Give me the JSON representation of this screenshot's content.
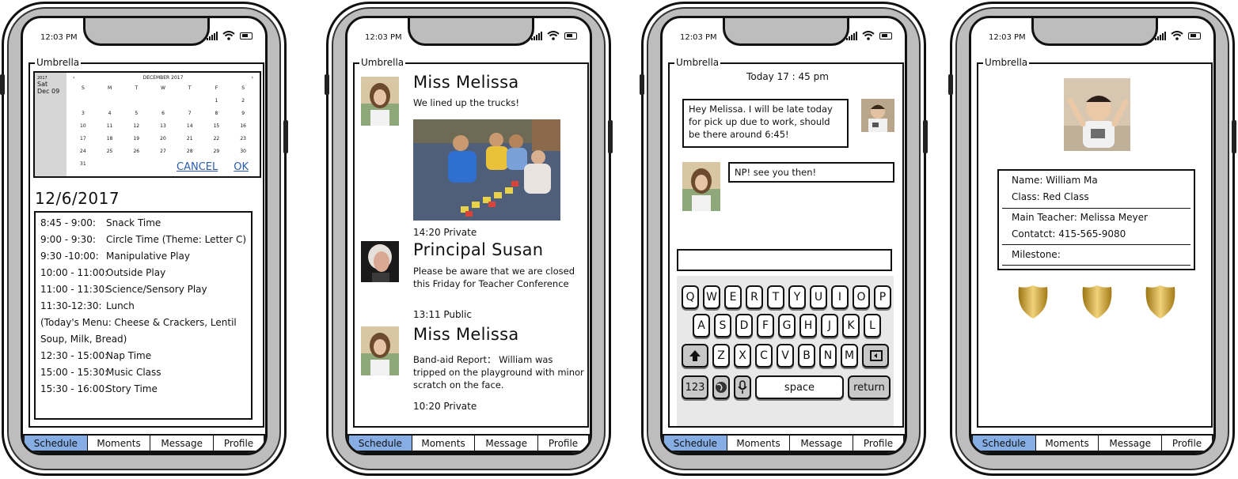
{
  "status": {
    "time": "12:03 PM"
  },
  "app": {
    "title": "Umbrella"
  },
  "tabs": [
    "Schedule",
    "Moments",
    "Message",
    "Profile"
  ],
  "calendar": {
    "year": "2017",
    "weekday": "Sat",
    "date": "Dec 09",
    "month_label": "DECEMBER 2017",
    "prev": "‹",
    "next": "›",
    "weekdays": [
      "S",
      "M",
      "T",
      "W",
      "T",
      "F",
      "S"
    ],
    "days": [
      "",
      "",
      "",
      "",
      "",
      "1",
      "2",
      "3",
      "4",
      "5",
      "6",
      "7",
      "8",
      "9",
      "10",
      "11",
      "12",
      "13",
      "14",
      "15",
      "16",
      "17",
      "18",
      "19",
      "20",
      "21",
      "22",
      "23",
      "24",
      "25",
      "26",
      "27",
      "28",
      "29",
      "30",
      "31"
    ],
    "selected_day": "9",
    "cancel": "CANCEL",
    "ok": "OK"
  },
  "schedule": {
    "date": "12/6/2017",
    "items": [
      {
        "time": "8:45 - 9:00:",
        "activity": "Snack Time"
      },
      {
        "time": "9:00 - 9:30:",
        "activity": "Circle Time (Theme: Letter C)"
      },
      {
        "time": "9:30 -10:00:",
        "activity": "Manipulative Play"
      },
      {
        "time": "10:00 - 11:00:",
        "activity": "Outside Play"
      },
      {
        "time": "11:00 - 11:30:",
        "activity": "Science/Sensory Play"
      },
      {
        "time": "11:30-12:30:",
        "activity": "Lunch"
      },
      {
        "time": "(Today's Menu: Cheese & Crackers, Lentil",
        "activity": ""
      },
      {
        "time": "Soup, Milk, Bread)",
        "activity": ""
      },
      {
        "time": "12:30 - 15:00:",
        "activity": "Nap Time"
      },
      {
        "time": "15:00 - 15:30:",
        "activity": "Music Class"
      },
      {
        "time": "15:30 - 16:00:",
        "activity": "Story Time"
      }
    ]
  },
  "moments": {
    "posts": [
      {
        "name": "Miss Melissa",
        "text": "We lined up the trucks!",
        "meta": "14:20 Private"
      },
      {
        "name": "Principal Susan",
        "text": "Please be aware that we are closed this Friday for Teacher Conference",
        "meta": "13:11 Public"
      },
      {
        "name": "Miss Melissa",
        "text": "Band-aid Report： William was tripped on the playground with minor scratch on the face.",
        "meta": "10:20 Private"
      }
    ]
  },
  "message": {
    "time": "Today 17 : 45 pm",
    "messages": [
      {
        "text": "Hey Melissa. I will be late today for pick up due to work, should be there around 6:45!"
      },
      {
        "text": "NP!  see you then!"
      }
    ],
    "input_value": "",
    "keyboard": {
      "row1": [
        "Q",
        "W",
        "E",
        "R",
        "T",
        "Y",
        "U",
        "I",
        "O",
        "P"
      ],
      "row2": [
        "A",
        "S",
        "D",
        "F",
        "G",
        "H",
        "J",
        "K",
        "L"
      ],
      "row3": [
        "Z",
        "X",
        "C",
        "V",
        "B",
        "N",
        "M"
      ],
      "numbers": "123",
      "space": "space",
      "return": "return",
      "shift_icon": "shift-arrow-icon",
      "backspace_icon": "backspace-icon",
      "globe_icon": "globe-icon",
      "mic_icon": "microphone-icon"
    }
  },
  "profile": {
    "name": "Name: William Ma",
    "class": "Class: Red Class",
    "teacher": "Main Teacher: Melissa Meyer",
    "contact": "Contatct: 415-565-9080",
    "milestone": "Milestone:",
    "badge_color": "#c9a227"
  },
  "colors": {
    "active_tab": "#87aee4",
    "shell": "#bdbdbd",
    "link": "#2a5db0"
  }
}
